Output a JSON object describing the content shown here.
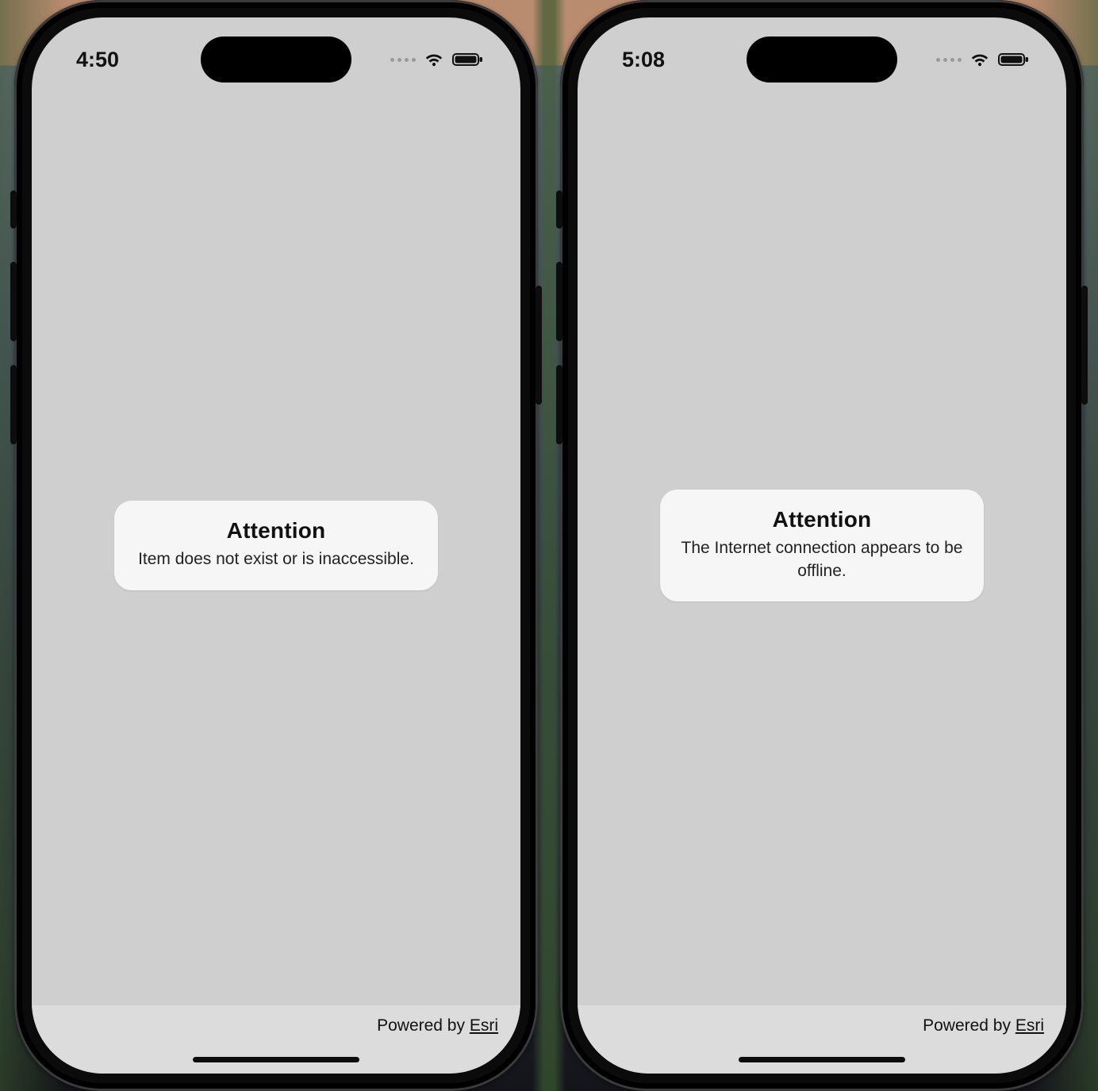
{
  "phones": [
    {
      "statusbar": {
        "time": "4:50"
      },
      "alert": {
        "title": "Attention",
        "message": "Item does not exist or is inaccessible."
      },
      "footer": {
        "powered_by_label": "Powered by ",
        "brand": "Esri"
      }
    },
    {
      "statusbar": {
        "time": "5:08"
      },
      "alert": {
        "title": "Attention",
        "message": "The Internet connection appears to be offline."
      },
      "footer": {
        "powered_by_label": "Powered by ",
        "brand": "Esri"
      }
    }
  ]
}
